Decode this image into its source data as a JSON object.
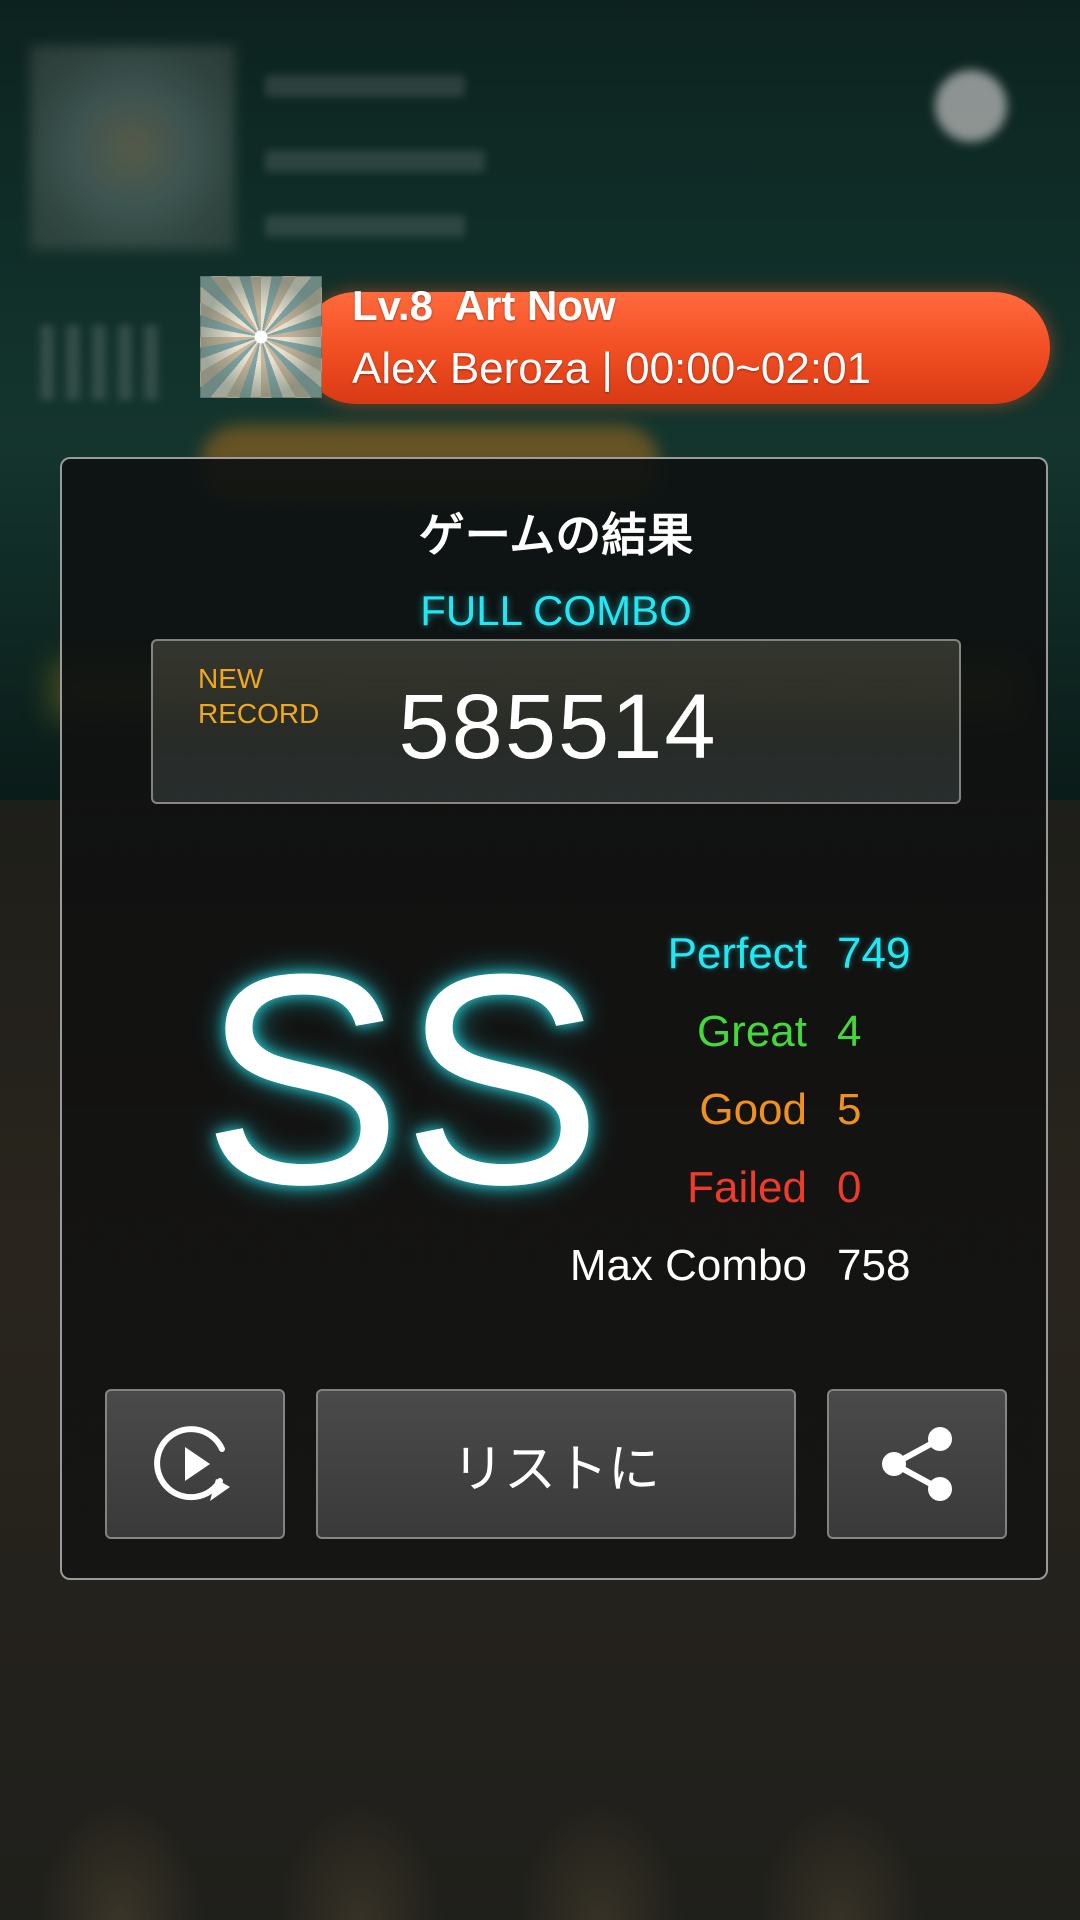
{
  "song": {
    "level": "Lv.8",
    "title": "Art Now",
    "artist_line": "Alex Beroza | 00:00~02:01"
  },
  "result": {
    "title": "ゲームの結果",
    "combo_status": "FULL COMBO",
    "new_record_line1": "NEW",
    "new_record_line2": "RECORD",
    "score": "585514",
    "rank": "SS",
    "stats": [
      {
        "label": "Perfect",
        "value": "749"
      },
      {
        "label": "Great",
        "value": "4"
      },
      {
        "label": "Good",
        "value": "5"
      },
      {
        "label": "Failed",
        "value": "0"
      },
      {
        "label": "Max Combo",
        "value": "758"
      }
    ]
  },
  "buttons": {
    "retry_icon": "replay-icon",
    "list_label": "リストに",
    "share_icon": "share-icon"
  },
  "colors": {
    "perfect": "#22e8f4",
    "great": "#44d83a",
    "good": "#f09020",
    "failed": "#f03a2a",
    "new_record": "#f2a81c",
    "banner": "#f04d22"
  }
}
